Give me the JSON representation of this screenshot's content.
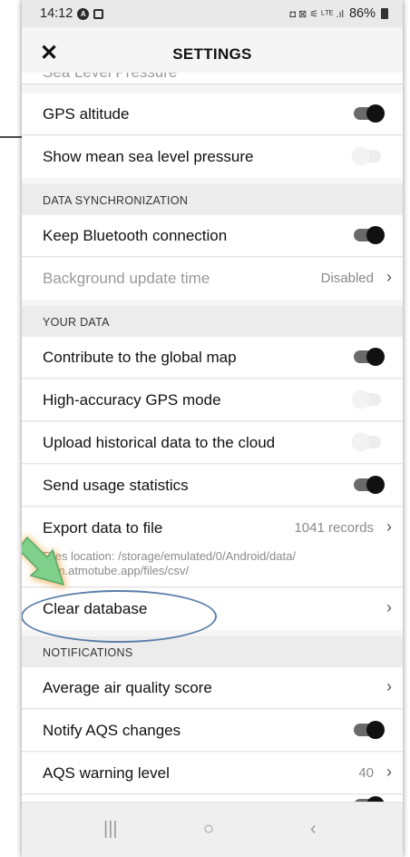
{
  "status_bar": {
    "time": "14:12",
    "right_icons": "◘ ⊠ ⚟ ᴸᵀᴱ .ıl",
    "battery": "86%"
  },
  "app_bar": {
    "close_symbol": "✕",
    "title": "SETTINGS"
  },
  "cut_off_item": "Sea Level Pressure",
  "rows": {
    "gps_altitude": "GPS altitude",
    "mean_sea_level": "Show mean sea level pressure",
    "keep_bluetooth": "Keep Bluetooth connection",
    "background_update": "Background update time",
    "background_update_value": "Disabled",
    "contribute_map": "Contribute to the global map",
    "high_accuracy_gps": "High-accuracy GPS mode",
    "upload_historical": "Upload historical data to the cloud",
    "usage_stats": "Send usage statistics",
    "export_data": "Export data to file",
    "export_records": "1041 records",
    "files_location": "Files location: /storage/emulated/0/Android/data/ com.atmotube.app/files/csv/",
    "clear_database": "Clear database",
    "avg_air_quality": "Average air quality score",
    "notify_aqs": "Notify AQS changes",
    "aqs_warning": "AQS warning level",
    "aqs_warning_value": "40"
  },
  "headers": {
    "data_sync": "DATA SYNCHRONIZATION",
    "your_data": "YOUR DATA",
    "notifications": "NOTIFICATIONS"
  },
  "toggles": {
    "gps_altitude": true,
    "mean_sea_level": false,
    "keep_bluetooth": true,
    "contribute_map": true,
    "high_accuracy_gps": false,
    "upload_historical": false,
    "usage_stats": true,
    "notify_aqs": true
  },
  "chevron": "›",
  "nav": {
    "recents": "|||",
    "home": "○",
    "back": "‹"
  },
  "colors": {
    "toggle_on": "#111111",
    "highlight_ring": "#5a7fa8",
    "arrow_green": "#7fd08a",
    "arrow_glow": "#f5a13a"
  }
}
